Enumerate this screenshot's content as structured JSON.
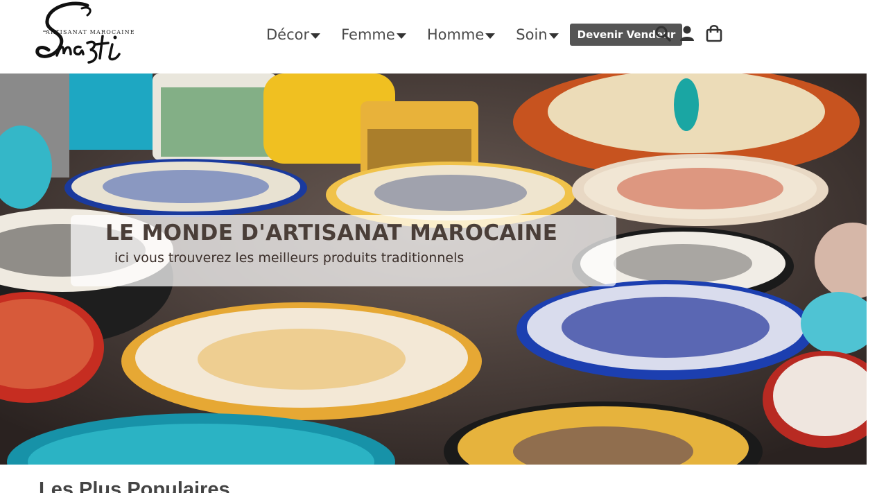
{
  "logo": {
    "wordmark": "Sna3ti",
    "tagline": "ARTISANAT MAROCAINE"
  },
  "nav": {
    "items": [
      {
        "label": "Décor",
        "icon": "caret-down-icon"
      },
      {
        "label": "Femme",
        "icon": "caret-down-icon"
      },
      {
        "label": "Homme",
        "icon": "caret-down-icon"
      },
      {
        "label": "Soin",
        "icon": "caret-down-icon"
      }
    ],
    "vendor_button": "Devenir Vendeur",
    "icons": [
      "search-icon",
      "user-icon",
      "shopping-bag-icon"
    ]
  },
  "hero": {
    "title": "LE MONDE D'ARTISANAT MAROCAINE",
    "subtitle": "ici vous trouverez les meilleurs produits traditionnels"
  },
  "section": {
    "title": "Les Plus Populaires"
  },
  "colors": {
    "header_bg": "#ffffff",
    "nav_text": "#4a4a4a",
    "vendor_button_bg": "#555555",
    "hero_title": "#4a3e38"
  }
}
